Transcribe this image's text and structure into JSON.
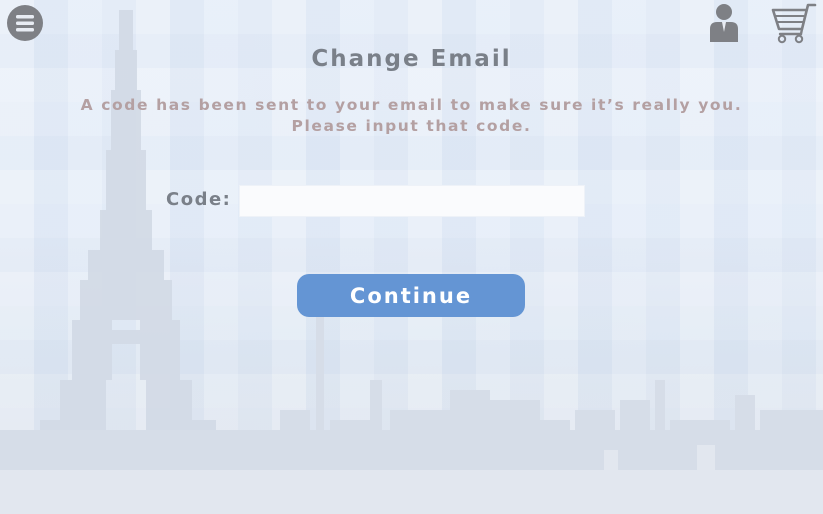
{
  "header": {
    "menu_icon": "hamburger-menu-icon",
    "user_icon": "user-account-icon",
    "cart_icon": "shopping-cart-icon"
  },
  "page": {
    "title": "Change Email",
    "message_line1": "A code has been sent to your email to make sure it’s really you.",
    "message_line2": "Please input that code."
  },
  "form": {
    "code_label": "Code:",
    "code_value": "",
    "code_placeholder": "",
    "continue_label": "Continue"
  },
  "colors": {
    "accent": "#6495d4",
    "title_text": "#7a8089",
    "message_text": "#b4a0a2",
    "icon": "#7e8085"
  }
}
